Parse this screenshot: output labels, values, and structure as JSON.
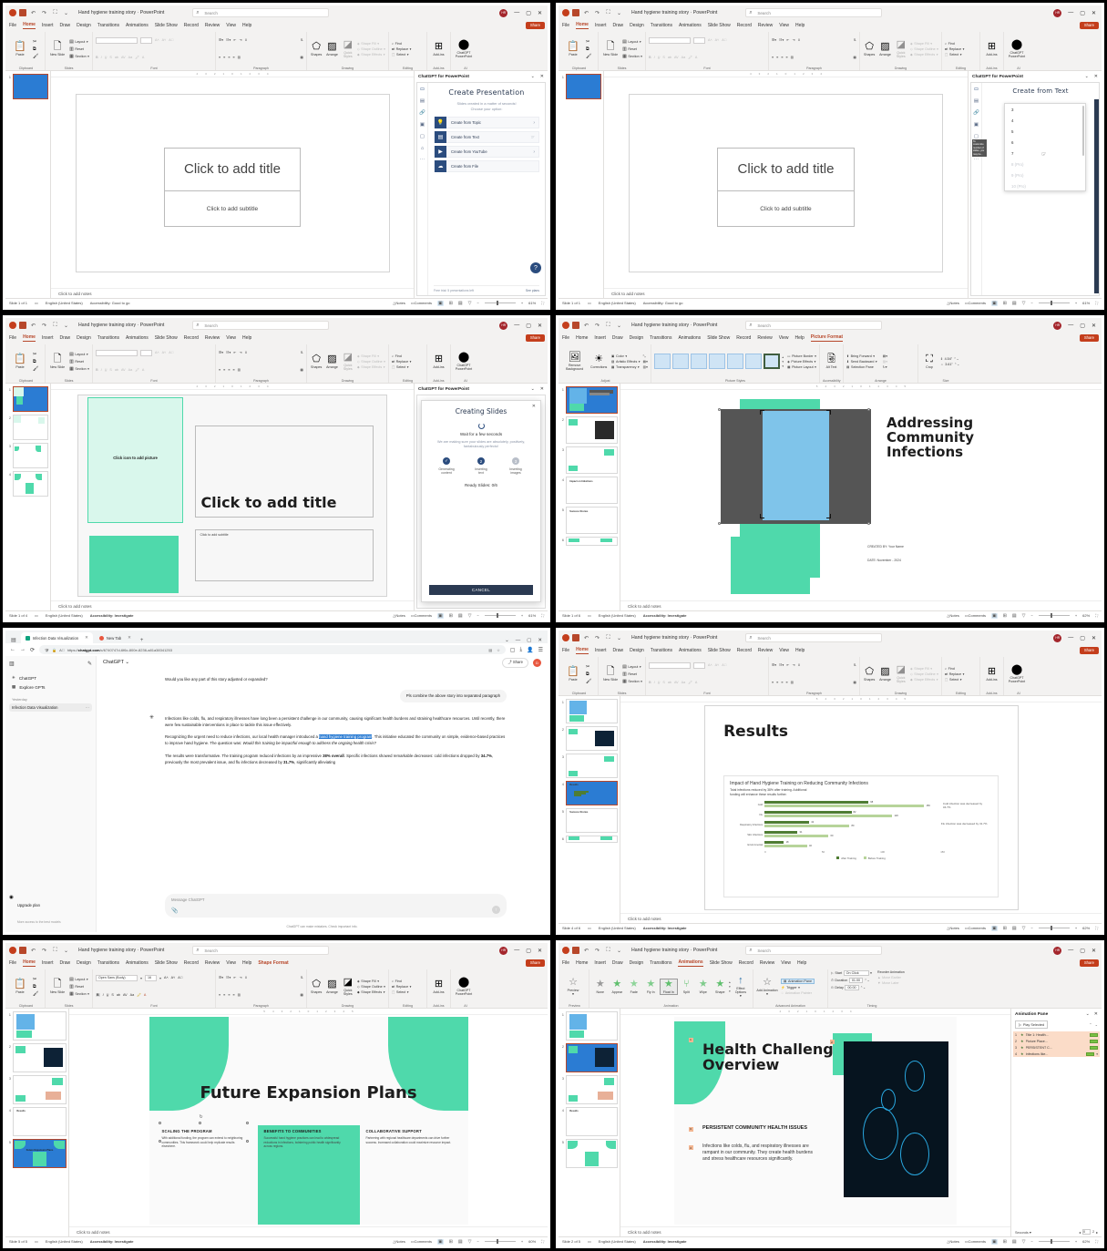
{
  "app": {
    "doc_title": "Hand hygiene training story",
    "product": "PowerPoint",
    "search_placeholder": "Search",
    "avatar_initials": "HR",
    "share_label": "Share",
    "minimize": "—",
    "maximize": "▢",
    "close": "✕"
  },
  "ribbon_tabs": [
    "File",
    "Home",
    "Insert",
    "Draw",
    "Design",
    "Transitions",
    "Animations",
    "Slide Show",
    "Record",
    "Review",
    "View",
    "Help"
  ],
  "home_ribbon": {
    "groups": [
      {
        "label": "Clipboard",
        "items": [
          "Paste",
          "Cut",
          "Copy",
          "Format Painter"
        ]
      },
      {
        "label": "Slides",
        "items": [
          "New Slide",
          "Layout",
          "Reset",
          "Section"
        ]
      },
      {
        "label": "Font",
        "items": [
          "Bold",
          "Italic",
          "Underline",
          "Strikethrough",
          "Text Shadow",
          "Character Spacing",
          "Change Case",
          "Text Highlight Color",
          "Font Color"
        ]
      },
      {
        "label": "Paragraph",
        "items": [
          "Bullets",
          "Numbering",
          "Decrease Indent",
          "Increase Indent",
          "Line Spacing",
          "Align Left",
          "Center",
          "Align Right",
          "Justify",
          "Columns",
          "Text Direction",
          "Align Text",
          "Convert to SmartArt"
        ]
      },
      {
        "label": "Drawing",
        "items": [
          "Shapes",
          "Arrange",
          "Quick Styles",
          "Shape Fill",
          "Shape Outline",
          "Shape Effects"
        ]
      },
      {
        "label": "Editing",
        "items": [
          "Find",
          "Replace",
          "Select"
        ]
      },
      {
        "label": "Add-ins",
        "items": [
          "Add-ins"
        ]
      },
      {
        "label": "AI",
        "items": [
          "ChatGPT PowerPoint"
        ]
      }
    ]
  },
  "picture_format_ribbon": {
    "tab_label": "Picture Format",
    "groups": [
      {
        "label": "Adjust",
        "items": [
          "Remove Background",
          "Corrections",
          "Color",
          "Artistic Effects",
          "Transparency",
          "Compress Pictures",
          "Change Picture",
          "Reset Picture"
        ]
      },
      {
        "label": "Picture Styles",
        "items": [
          "Picture Border",
          "Picture Effects",
          "Picture Layout"
        ]
      },
      {
        "label": "Accessibility",
        "items": [
          "Alt Text"
        ]
      },
      {
        "label": "Arrange",
        "items": [
          "Bring Forward",
          "Send Backward",
          "Selection Pane",
          "Align",
          "Group",
          "Rotate"
        ]
      },
      {
        "label": "Size",
        "items": [
          "Crop"
        ],
        "height": "4.54\"",
        "width": "3.61\""
      }
    ]
  },
  "animations_ribbon": {
    "tab_label": "Animations",
    "preview_label": "Preview",
    "preview_group": "Preview",
    "effects": [
      "None",
      "Appear",
      "Fade",
      "Fly In",
      "Float In",
      "Split",
      "Wipe",
      "Shape"
    ],
    "selected_effect": "Float In",
    "effect_options": "Effect Options",
    "animation_group": "Animation",
    "advanced": {
      "group": "Advanced Animation",
      "add_animation": "Add Animation",
      "animation_pane": "Animation Pane",
      "trigger": "Trigger",
      "animation_painter": "Animation Painter"
    },
    "timing": {
      "group": "Timing",
      "start_label": "Start",
      "start_value": "On Click",
      "duration_label": "Duration",
      "duration_value": "01.00",
      "delay_label": "Delay",
      "delay_value": "00.00",
      "reorder_label": "Reorder Animation",
      "move_earlier": "Move Earlier",
      "move_later": "Move Later"
    }
  },
  "shape_format_ribbon": {
    "tab_label": "Shape Format",
    "font_name": "Open Sans (Body)",
    "font_size": "16"
  },
  "status_bar": {
    "notes_label": "Notes",
    "comments_label": "Comments",
    "notes_placeholder": "Click to add notes",
    "accessibility_good": "Accessibility: Good to go",
    "accessibility_investigate": "Accessibility: Investigate",
    "language": "English (United States)"
  },
  "chatgpt_pane": {
    "title": "ChatGPT for PowerPoint",
    "collapse": "⌄",
    "close": "✕",
    "heading_create": "Create Presentation",
    "subtitle_l1": "Slides created in a matter of seconds!",
    "subtitle_l2": "Choose your option:",
    "options": [
      {
        "label": "Create from Topic",
        "icon": "lightbulb-icon"
      },
      {
        "label": "Create from Text",
        "icon": "text-lines-icon"
      },
      {
        "label": "Create from YouTube",
        "icon": "play-icon"
      },
      {
        "label": "Create from File",
        "icon": "cloud-upload-icon"
      }
    ],
    "footer_trial": "Free trial: 5 presentations left",
    "footer_link": "See plans",
    "help_badge": "?",
    "rail_icons": [
      "chat-icon",
      "document-icon",
      "link-icon",
      "image-icon",
      "note-icon",
      "briefcase-icon",
      "more-icon"
    ]
  },
  "create_from_text": {
    "heading": "Create from Text",
    "dropdown_options": [
      "3",
      "4",
      "5",
      "6",
      "7",
      "8 (Pro)",
      "9 (Pro)",
      "10 (Pro)"
    ],
    "tooltip": "To customize number of slides, you may be..."
  },
  "creating_slides_modal": {
    "title": "Creating Slides",
    "wait_text": "Wait for a few seconds",
    "description": "We are making sure your slides are absolutely, positively, fantabulously perfecto!",
    "steps": [
      {
        "label_l1": "Generating",
        "label_l2": "content",
        "state": "done",
        "marker": "✓"
      },
      {
        "label_l1": "Inserting",
        "label_l2": "text",
        "state": "active",
        "marker": "2"
      },
      {
        "label_l1": "Inserting",
        "label_l2": "images",
        "state": "pending",
        "marker": "3"
      }
    ],
    "ready_label": "Ready Slides: 0/6",
    "cancel_label": "CANCEL"
  },
  "animation_pane": {
    "title": "Animation Pane",
    "play_selected": "Play Selected",
    "items": [
      {
        "index": "1",
        "name": "Title 1: Health..."
      },
      {
        "index": "2",
        "name": "Picture Place..."
      },
      {
        "index": "3",
        "name": "PERSISTENT C..."
      },
      {
        "index": "4",
        "name": "Infections like..."
      }
    ],
    "seconds_label": "Seconds",
    "tick_0": "0",
    "tick_2": "2"
  },
  "browser": {
    "tabs": [
      {
        "title": "Infection Data Visualization",
        "active": true,
        "favicon": "chatgpt-favicon"
      },
      {
        "title": "New Tab",
        "active": false,
        "favicon": "firefox-favicon"
      }
    ],
    "url_prefix": "https://",
    "url_domain": "chatgpt.com",
    "url_path": "/c/6740747d-6f6c-800e-8236-a81a38341253",
    "new_tab": "+",
    "back": "←",
    "forward": "→",
    "reload": "⟳"
  },
  "chatgpt_web": {
    "model_label": "ChatGPT",
    "share_label": "Share",
    "avatar_initials": "D",
    "nav": [
      {
        "label": "ChatGPT",
        "icon": "chatgpt-icon"
      },
      {
        "label": "Explore GPTs",
        "icon": "grid-icon"
      }
    ],
    "history_section": "Yesterday",
    "history_items": [
      "Infection Data Visualization"
    ],
    "upgrade_title": "Upgrade plan",
    "upgrade_sub": "More access to the best models",
    "input_placeholder": "Message ChatGPT",
    "disclaimer": "ChatGPT can make mistakes. Check important info.",
    "messages": [
      {
        "role": "assistant",
        "text": "Would you like any part of this story adjusted or expanded?"
      },
      {
        "role": "user",
        "text": "Pls combine the above story into separated paragraph"
      },
      {
        "role": "assistant",
        "paragraphs": [
          "Infections like colds, flu, and respiratory illnesses have long been a persistent challenge in our community, causing significant health burdens and straining healthcare resources. Until recently, there were few sustainable interventions in place to tackle this issue effectively.",
          "Recognizing the urgent need to reduce infections, our local health manager introduced a hand hygiene training program. This initiative educated the community on simple, evidence-based practices to improve hand hygiene. The question was: Would this training be impactful enough to address the ongoing health crisis?",
          "The results were transformative. The training program reduced infections by an impressive 38% overall. Specific infections showed remarkable decreases: cold infections dropped by 34.7%, previously the most prevalent issue, and flu infections decreased by 31.7%, significantly alleviating"
        ],
        "selection": "hand hygiene training program"
      }
    ]
  },
  "panels": [
    {
      "id": "panel-1",
      "active_tab": "Home",
      "slide_status": "Slide 1 of 1",
      "accessibility": "Accessibility: Good to go",
      "zoom": "61%",
      "slide": {
        "title_ph": "Click to add title",
        "subtitle_ph": "Click to add subtitle"
      },
      "thumb_count": 1
    },
    {
      "id": "panel-2",
      "active_tab": "Home",
      "slide_status": "Slide 1 of 1",
      "accessibility": "Accessibility: Good to go",
      "zoom": "61%",
      "slide": {
        "title_ph": "Click to add title",
        "subtitle_ph": "Click to add subtitle"
      },
      "thumb_count": 1
    },
    {
      "id": "panel-3",
      "active_tab": "Home",
      "slide_status": "Slide 1 of 4",
      "accessibility": "Accessibility: Investigate",
      "zoom": "61%",
      "slide": {
        "title_ph": "Click to add title",
        "subtitle_ph": "Click to add subtitle",
        "picture_ph": "Click icon to add picture"
      },
      "thumb_count": 4
    },
    {
      "id": "panel-4",
      "active_tab": "Picture Format",
      "slide_status": "Slide 1 of 6",
      "accessibility": "Accessibility: Investigate",
      "zoom": "62%",
      "slide": {
        "title_l1": "Addressing",
        "title_l2": "Community",
        "title_l3": "Infections",
        "created_by": "CREATED BY: Your Name",
        "date": "DATE: November - 2024"
      },
      "thumb_count": 6
    },
    {
      "id": "panel-5",
      "type": "browser"
    },
    {
      "id": "panel-6",
      "active_tab": "Home",
      "slide_status": "Slide 4 of 6",
      "accessibility": "Accessibility: Investigate",
      "zoom": "62%",
      "slide": {
        "title": "Results"
      },
      "thumb_count": 6
    },
    {
      "id": "panel-7",
      "active_tab": "Home",
      "context_tab": "Shape Format",
      "slide_status": "Slide 5 of 5",
      "accessibility": "Accessibility: Investigate",
      "zoom": "60%",
      "slide": {
        "title": "Future Expansion Plans",
        "columns": [
          {
            "heading": "SCALING THE PROGRAM",
            "body": "With additional funding, the program can extend to neighboring communities. This framework could help replicate results elsewhere."
          },
          {
            "heading": "BENEFITS TO COMMUNITIES",
            "body": "Successful hand hygiene practices can lead to widespread reductions in infections, bolstering public health significantly across regions."
          },
          {
            "heading": "COLLABORATIVE SUPPORT",
            "body": "Partnering with regional healthcare departments can drive further success. Increased collaboration could maximize resource impact."
          }
        ]
      },
      "thumb_count": 5
    },
    {
      "id": "panel-8",
      "active_tab": "Animations",
      "slide_status": "Slide 2 of 5",
      "accessibility": "Accessibility: Investigate",
      "zoom": "62%",
      "slide": {
        "title_l1": "Health Challenge",
        "title_l2": "Overview",
        "subhead": "PERSISTENT COMMUNITY HEALTH ISSUES",
        "body": "Infections like colds, flu, and respiratory illnesses are rampant in our community. They create health burdens and stress healthcare resources significantly."
      },
      "thumb_count": 5
    }
  ],
  "chart_data": {
    "type": "bar",
    "orientation": "horizontal",
    "title": "Impact of Hand Hygiene Training on Reducing Community Infections",
    "subtitle_l1": "Total infections reduced by 38% after training. Additional",
    "subtitle_l2": "funding will enhance these results further.",
    "categories": [
      "Cold",
      "Flu",
      "Respiratory Infections",
      "Skin Infections",
      "Environmental"
    ],
    "series": [
      {
        "name": "After Training",
        "values": [
          98,
          82,
          42,
          31,
          18
        ],
        "color": "#4f7d33"
      },
      {
        "name": "Before Training",
        "values": [
          150,
          120,
          80,
          60,
          40
        ],
        "color": "#b7d49a"
      }
    ],
    "xlabel": "",
    "ylabel": "",
    "xlim": [
      0,
      150
    ],
    "xticks": [
      "0",
      "50",
      "100",
      "150"
    ],
    "legend_position": "bottom",
    "grid": true,
    "annotations": [
      "Cold infection was decreased by 34.7%",
      "Flu infection was decreased by 31.7%"
    ]
  },
  "colors": {
    "accent_mint": "#4fd9ab",
    "accent_mint_light": "#d9f7ec",
    "brand_red": "#c43e1c",
    "chart_dark_green": "#4f7d33",
    "chart_light_green": "#b7d49a",
    "gpt_navy": "#2b4c7e",
    "anim_row": "#fbdcc8"
  }
}
